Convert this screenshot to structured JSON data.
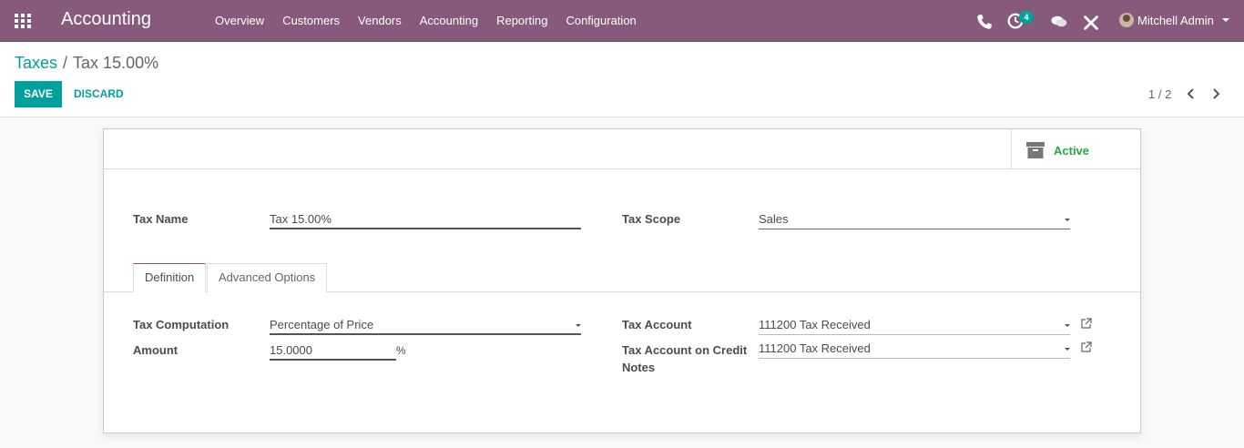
{
  "navbar": {
    "app_name": "Accounting",
    "menu": [
      "Overview",
      "Customers",
      "Vendors",
      "Accounting",
      "Reporting",
      "Configuration"
    ],
    "activity_count": "4",
    "user_name": "Mitchell Admin",
    "brand_color": "#875a7b"
  },
  "breadcrumb": {
    "parent": "Taxes",
    "separator": "/",
    "current": "Tax 15.00%"
  },
  "actions": {
    "save": "SAVE",
    "discard": "DISCARD"
  },
  "pager": {
    "text": "1 / 2"
  },
  "button_box": {
    "active_label": "Active"
  },
  "form": {
    "tax_name_label": "Tax Name",
    "tax_name_value": "Tax 15.00%",
    "tax_scope_label": "Tax Scope",
    "tax_scope_value": "Sales"
  },
  "tabs": {
    "definition": "Definition",
    "advanced": "Advanced Options"
  },
  "definition": {
    "computation_label": "Tax Computation",
    "computation_value": "Percentage of Price",
    "amount_label": "Amount",
    "amount_value": "15.0000",
    "amount_unit": "%",
    "tax_account_label": "Tax Account",
    "tax_account_value": "111200 Tax Received",
    "credit_account_label_1": "Tax Account on Credit",
    "credit_account_label_2": "Notes",
    "credit_account_value": "111200 Tax Received"
  }
}
